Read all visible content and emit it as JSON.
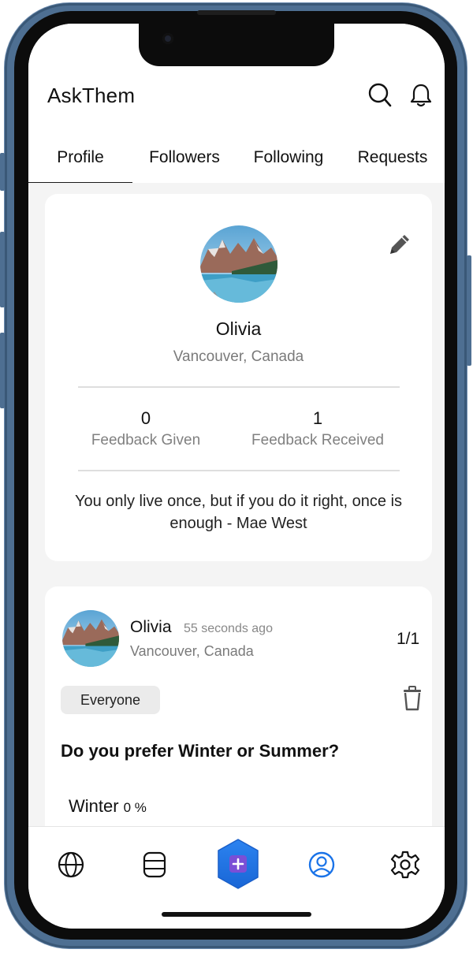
{
  "app": {
    "title": "AskThem"
  },
  "header": {
    "icons": [
      "search-icon",
      "bell-icon"
    ]
  },
  "tabs": [
    {
      "label": "Profile",
      "active": true
    },
    {
      "label": "Followers",
      "active": false
    },
    {
      "label": "Following",
      "active": false
    },
    {
      "label": "Requests",
      "active": false
    }
  ],
  "profile": {
    "name": "Olivia",
    "location": "Vancouver, Canada",
    "stats": [
      {
        "value": "0",
        "label": "Feedback Given"
      },
      {
        "value": "1",
        "label": "Feedback Received"
      }
    ],
    "quote": "You only live once, but if you do it right, once is enough  - Mae West"
  },
  "post": {
    "author": "Olivia",
    "time": "55 seconds ago",
    "location": "Vancouver, Canada",
    "counter": "1/1",
    "audience": "Everyone",
    "question": "Do you prefer Winter or Summer?",
    "options": [
      {
        "label": "Winter",
        "percent": "0 %"
      }
    ]
  },
  "bottom_nav": {
    "items": [
      "globe-icon",
      "feed-icon",
      "add-post-icon",
      "profile-icon",
      "settings-icon"
    ],
    "active": "profile-icon"
  },
  "colors": {
    "accent": "#1a73e8",
    "fab": "#2f7be8",
    "fab_plus_bg": "#7a4fd6"
  }
}
